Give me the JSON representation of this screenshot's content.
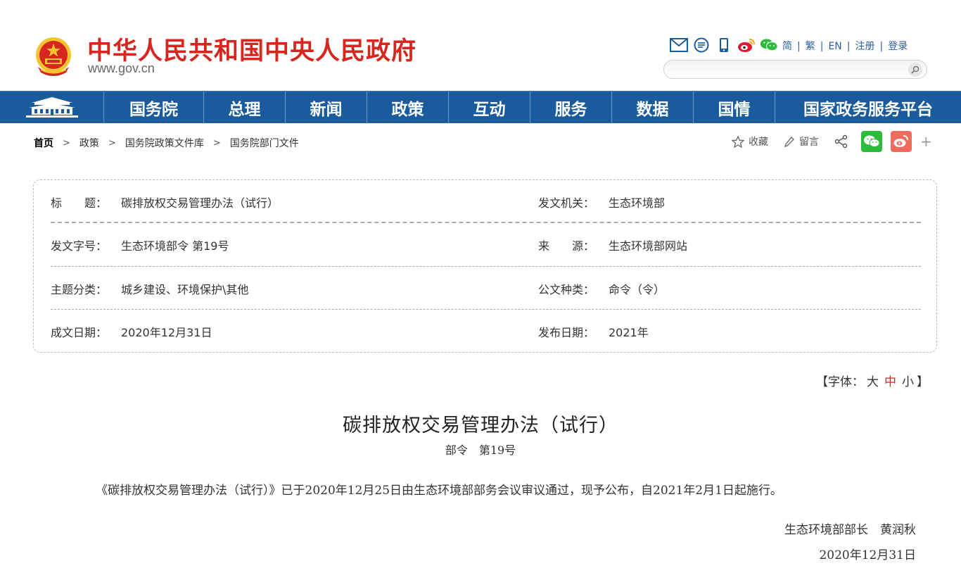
{
  "header": {
    "site_title": "中华人民共和国中央人民政府",
    "site_url": "www.gov.cn",
    "top_icons": [
      "mail-icon",
      "chat-icon",
      "mobile-icon",
      "weibo-icon",
      "wechat-icon"
    ],
    "lang_links": [
      "简",
      "繁",
      "EN",
      "注册",
      "登录"
    ],
    "search_placeholder": ""
  },
  "nav": {
    "items": [
      "国务院",
      "总理",
      "新闻",
      "政策",
      "互动",
      "服务",
      "数据",
      "国情",
      "国家政务服务平台"
    ]
  },
  "breadcrumb": [
    "首页",
    "政策",
    "国务院政策文件库",
    "国务院部门文件"
  ],
  "share": {
    "favorite_label": "收藏",
    "comment_label": "留言"
  },
  "info": {
    "title_label": "标　　题：",
    "title_value": "碳排放权交易管理办法（试行）",
    "issuer_label": "发文机关：",
    "issuer_value": "生态环境部",
    "doc_no_label": "发文字号：",
    "doc_no_value": "生态环境部令 第19号",
    "source_label": "来　　源：",
    "source_value": "生态环境部网站",
    "topic_label": "主题分类：",
    "topic_value": "城乡建设、环境保护\\其他",
    "doc_type_label": "公文种类：",
    "doc_type_value": "命令（令）",
    "written_date_label": "成文日期：",
    "written_date_value": "2020年12月31日",
    "publish_date_label": "发布日期：",
    "publish_date_value": "2021年"
  },
  "font_size": {
    "prefix": "【字体：",
    "large": "大",
    "medium": "中",
    "small": "小",
    "suffix": "】",
    "active_color": "#d7261d"
  },
  "article": {
    "title": "碳排放权交易管理办法（试行）",
    "subtitle": "部令　第19号",
    "body": "《碳排放权交易管理办法（试行）》已于2020年12月25日由生态环境部部务会议审议通过，现予公布，自2021年2月1日起施行。",
    "signer": "生态环境部部长　黄润秋",
    "sign_date": "2020年12月31日"
  },
  "colors": {
    "brand_red": "#d7261d",
    "nav_blue": "#1a5b9e",
    "link_blue": "#2c5ea6",
    "wechat_green": "#2dbb3a",
    "weibo_red": "#f06b5e"
  }
}
